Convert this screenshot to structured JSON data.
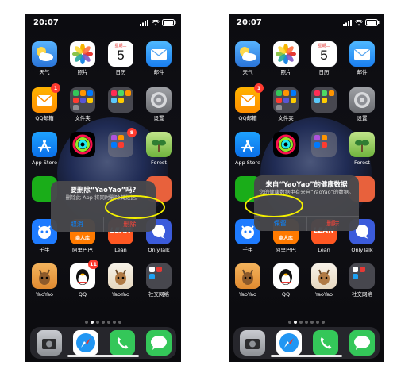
{
  "status": {
    "time": "20:07"
  },
  "apps": {
    "row1": [
      "天气",
      "照片",
      "日历",
      "邮件"
    ],
    "calendar_day": "5",
    "calendar_weekday": "星期二",
    "row2": [
      "QQ邮箱",
      "文件夹",
      "",
      "设置"
    ],
    "row2_badges": [
      "1",
      "",
      "",
      ""
    ],
    "row3_left": [
      "App Store",
      "",
      "",
      "Forest"
    ],
    "row3_badges_left": [
      "",
      "",
      "8",
      ""
    ],
    "row3_right": [
      "App Store",
      "",
      "",
      "Forest"
    ],
    "row3_badges_right": [
      "",
      "",
      "",
      ""
    ],
    "row5": [
      "千牛",
      "阿里巴巴",
      "Lean",
      "OnlyTalk"
    ],
    "row5_badges": [
      "",
      "",
      "",
      ""
    ],
    "row6": [
      "YaoYao",
      "QQ",
      "YaoYao",
      "社交网络"
    ],
    "row6_badges": [
      "",
      "11",
      "",
      ""
    ],
    "lean_text": "LEAN",
    "alibaba_text": "商人库"
  },
  "left_dialog": {
    "title": "要删除“YaoYao”吗?",
    "message": "删除此 App 将同时删除其数据。",
    "cancel": "取消",
    "delete": "删除"
  },
  "right_dialog": {
    "title": "来自“YaoYao”的健康数据",
    "message": "您的健康数据中有来自“YaoYao”的数据。",
    "keep": "保留",
    "delete": "删除"
  },
  "colors": {
    "accent_blue": "#0a84ff",
    "destructive_red": "#ff453a",
    "annotation_yellow": "#f4f000"
  }
}
